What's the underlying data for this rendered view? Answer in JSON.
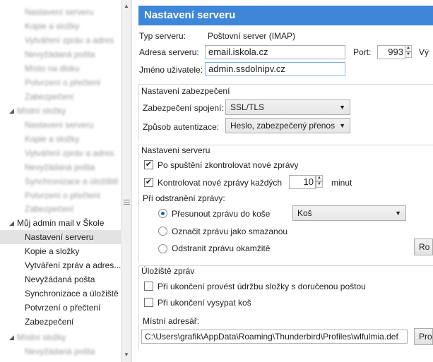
{
  "tree": {
    "blurred_items_top": [
      "Nastavení serveru",
      "Kopie a složky",
      "Vytváření zpráv a adres",
      "Nevyžádaná pošta",
      "Místo na disku",
      "Potvrzení o přečtení",
      "Zabezpečení"
    ],
    "blurred_account": "Místní složky",
    "blurred_items_mid": [
      "Nastavení serveru",
      "Kopie a složky",
      "Vytváření zpráv a adres",
      "Nevyžádaná pošta",
      "Synchronizace a úložiště",
      "Potvrzení o přečtení",
      "Zabezpečení"
    ],
    "account": "Můj admin mail v Škole",
    "items": [
      "Nastavení serveru",
      "Kopie a složky",
      "Vytváření zpráv a adres...",
      "Nevyžádaná pošta",
      "Synchronizace a úložiště",
      "Potvrzení o přečtení",
      "Zabezpečení"
    ],
    "blurred_items_bottom": [
      "Místní složky",
      "Nevyžádaná pošta"
    ]
  },
  "header": {
    "title": "Nastavení serveru"
  },
  "server": {
    "type_label": "Typ serveru:",
    "type_value": "Poštovní server (IMAP)",
    "address_label": "Adresa serveru:",
    "address_value": "email.iskola.cz",
    "port_label": "Port:",
    "port_value": "993",
    "port_default_label": "Vý",
    "username_label": "Jméno uživatele:",
    "username_value": "admin.ssdolnipv.cz"
  },
  "security": {
    "title": "Nastavení zabezpečení",
    "connection_label": "Zabezpečení spojení:",
    "connection_value": "SSL/TLS",
    "auth_label": "Způsob autentizace:",
    "auth_value": "Heslo, zabezpečený přenos"
  },
  "settings": {
    "title": "Nastavení serveru",
    "check_on_start_label": "Po spuštění zkontrolovat nové zprávy",
    "check_on_start": true,
    "check_every_label": "Kontrolovat nové zprávy každých",
    "check_every": true,
    "check_every_value": "10",
    "check_every_unit": "minut",
    "on_delete_label": "Při odstranění zprávy:",
    "move_label": "Přesunout zprávu do koše",
    "move_folder": "Koš",
    "mark_label": "Označit zprávu jako smazanou",
    "remove_label": "Odstranit zprávu okamžitě",
    "advanced_button": "Ro",
    "selected_option": "move"
  },
  "storage": {
    "title": "Úložiště zpráv",
    "cleanup_label": "Při ukončení provést údržbu složky s doručenou poštou",
    "cleanup": false,
    "empty_trash_label": "Při ukončení vysypat koš",
    "empty_trash": false,
    "local_dir_label": "Místní adresář:",
    "local_dir_value": "C:\\Users\\grafik\\AppData\\Roaming\\Thunderbird\\Profiles\\wlfulmia.def",
    "browse_button": "Pro"
  },
  "colors": {
    "header_bg": "#3d86d8",
    "selection_bg": "#e3e3e3"
  }
}
